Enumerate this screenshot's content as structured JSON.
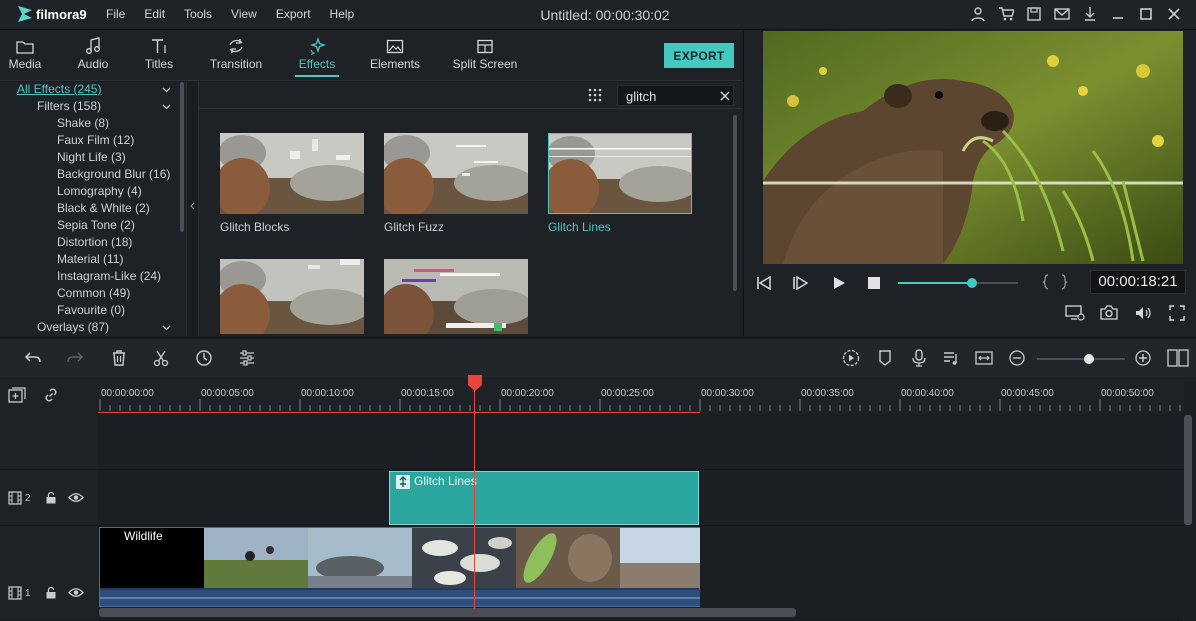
{
  "app": {
    "name": "filmora9",
    "window_title": "Untitled:  00:00:30:02"
  },
  "menu": [
    "File",
    "Edit",
    "Tools",
    "View",
    "Export",
    "Help"
  ],
  "tabs": [
    {
      "label": "Media",
      "icon": "folder-icon"
    },
    {
      "label": "Audio",
      "icon": "music-note-icon"
    },
    {
      "label": "Titles",
      "icon": "text-icon"
    },
    {
      "label": "Transition",
      "icon": "transition-icon"
    },
    {
      "label": "Effects",
      "icon": "sparkle-icon",
      "active": true
    },
    {
      "label": "Elements",
      "icon": "image-icon"
    },
    {
      "label": "Split Screen",
      "icon": "split-screen-icon"
    }
  ],
  "export_label": "EXPORT",
  "tree": {
    "all_effects": "All Effects (245)",
    "filters": "Filters (158)",
    "items": [
      "Shake (8)",
      "Faux Film (12)",
      "Night Life (3)",
      "Background Blur (16)",
      "Lomography (4)",
      "Black & White (2)",
      "Sepia Tone (2)",
      "Distortion (18)",
      "Material (11)",
      "Instagram-Like (24)",
      "Common (49)",
      "Favourite (0)"
    ],
    "overlays": "Overlays (87)"
  },
  "search": {
    "value": "glitch"
  },
  "effects": [
    {
      "label": "Glitch Blocks",
      "selected": false
    },
    {
      "label": "Glitch Fuzz",
      "selected": false
    },
    {
      "label": "Glitch Lines",
      "selected": true
    },
    {
      "label": "",
      "selected": false
    },
    {
      "label": "",
      "selected": false
    }
  ],
  "preview": {
    "timecode": "00:00:18:21",
    "progress": 0.62
  },
  "ruler": [
    "00:00:00:00",
    "00:00:05:00",
    "00:00:10:00",
    "00:00:15:00",
    "00:00:20:00",
    "00:00:25:00",
    "00:00:30:00",
    "00:00:35:00",
    "00:00:40:00",
    "00:00:45:00",
    "00:00:50:00"
  ],
  "tracks": [
    {
      "id": "2",
      "clip": "Glitch Lines"
    },
    {
      "id": "1",
      "clip": "Wildlife"
    }
  ],
  "colors": {
    "accent": "#43c9bf",
    "playhead": "#e8463d",
    "effect_clip": "#2aa69e",
    "video_clip": "#2f4e7a"
  }
}
